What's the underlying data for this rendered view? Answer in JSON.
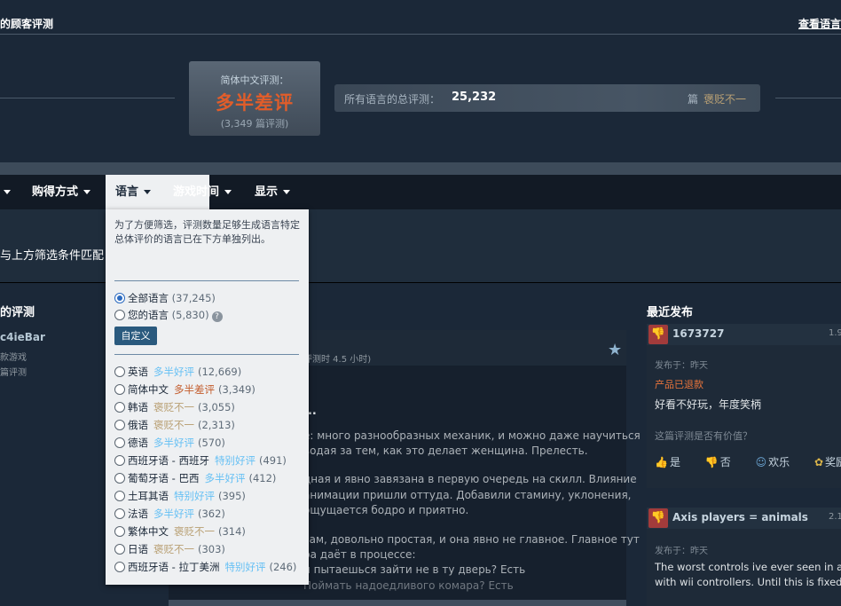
{
  "header": {
    "title": "的顾客评测",
    "link": "查看语言"
  },
  "score": {
    "label": "简体中文评测：",
    "value": "多半差评",
    "count": "(3,349 篇评测)"
  },
  "all_languages": {
    "label": "所有语言的总评测：",
    "count": "25,232",
    "suffix": "篇",
    "rating": "褒贬不一"
  },
  "filter_bar": {
    "items": [
      "购得方式",
      "语言",
      "游戏时间",
      "显示"
    ]
  },
  "summary": {
    "text": "与上方筛选条件匹配"
  },
  "reviews": {
    "heading": "的评测",
    "reviewer": {
      "name": "c4ieBar",
      "games": "款游戏",
      "reviews": "篇评测"
    },
    "hours": "评测时 4.5 小时)",
    "title": "...",
    "lines": [
      "е: много разнообразных механик, и можно даже научиться",
      "водая за тем, как это делает женщина. Прелесть.",
      "дная и явно завязана в первую очередь на скилл. Влияние",
      "анимации пришли оттуда. Добавили стамину, уклонения,",
      "ощущается бодро и приятно.",
      "сам, довольно простая, и она явно не главное. Главное тут",
      "ра даёт в процессе:",
      "и пытаешься зайти не в ту дверь? Есть",
      "Поймать надоедливого комара? Есть"
    ]
  },
  "recent": {
    "heading": "最近发布",
    "cards": [
      {
        "name": "1673727",
        "hours": "1.9",
        "date": "发布于：昨天",
        "refund": "产品已退款",
        "body": "好看不好玩，年度笑柄",
        "question": "这篇评测是否有价值？",
        "votes": [
          "是",
          "否",
          "欢乐",
          "奖励"
        ]
      },
      {
        "name": "Axis players = animals",
        "hours": "2.1",
        "date": "发布于：昨天",
        "body_lines": [
          "The worst controls ive ever seen in a",
          "with wii controllers. Until this is fixed,"
        ]
      }
    ]
  },
  "language_dropdown": {
    "note": "为了方便筛选，评测数量足够生成语言特定总体评价的语言已在下方单独列出。",
    "all_languages": {
      "label": "全部语言",
      "count": "(37,245)"
    },
    "your_languages": {
      "label": "您的语言",
      "count": "(5,830)"
    },
    "custom_button": "自定义",
    "help_icon": "?",
    "languages": [
      {
        "name": "英语",
        "rating": "多半好评",
        "count": "(12,669)",
        "tone": "pos"
      },
      {
        "name": "简体中文",
        "rating": "多半差评",
        "count": "(3,349)",
        "tone": "neg"
      },
      {
        "name": "韩语",
        "rating": "褒贬不一",
        "count": "(3,055)",
        "tone": "mixed"
      },
      {
        "name": "俄语",
        "rating": "褒贬不一",
        "count": "(2,313)",
        "tone": "mixed"
      },
      {
        "name": "德语",
        "rating": "多半好评",
        "count": "(570)",
        "tone": "pos"
      },
      {
        "name": "西班牙语 - 西班牙",
        "rating": "特别好评",
        "count": "(491)",
        "tone": "pos"
      },
      {
        "name": "葡萄牙语 - 巴西",
        "rating": "多半好评",
        "count": "(412)",
        "tone": "pos"
      },
      {
        "name": "土耳其语",
        "rating": "特别好评",
        "count": "(395)",
        "tone": "pos"
      },
      {
        "name": "法语",
        "rating": "多半好评",
        "count": "(362)",
        "tone": "pos"
      },
      {
        "name": "繁体中文",
        "rating": "褒贬不一",
        "count": "(314)",
        "tone": "mixed"
      },
      {
        "name": "日语",
        "rating": "褒贬不一",
        "count": "(303)",
        "tone": "mixed"
      },
      {
        "name": "西班牙语 - 拉丁美洲",
        "rating": "特别好评",
        "count": "(246)",
        "tone": "pos"
      }
    ]
  },
  "colors": {
    "background": "#1b2838",
    "positive": "#66c0f4",
    "mixed": "#b9a074",
    "negative": "#c35c2c",
    "score_negative": "#e15d2a"
  }
}
